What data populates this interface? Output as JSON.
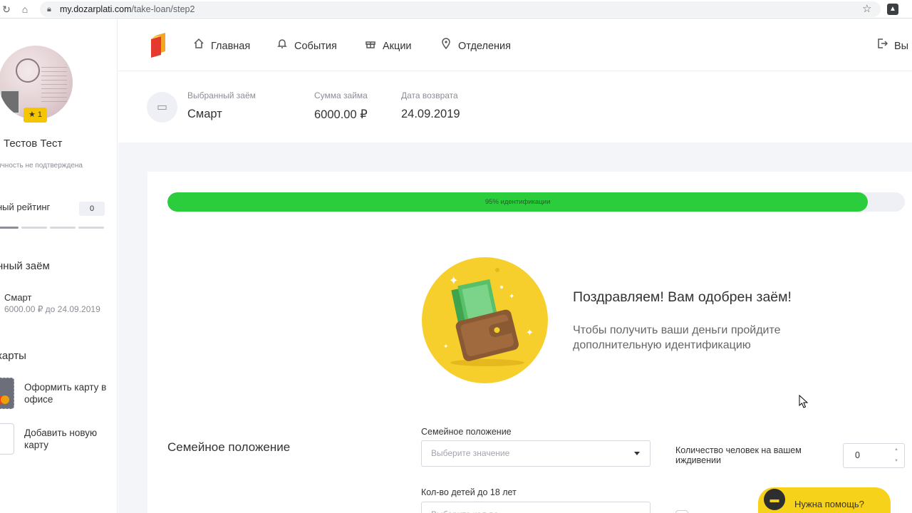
{
  "browser": {
    "url_host": "my.dozarplati.com",
    "url_path": "/take-loan/step2"
  },
  "sidebar": {
    "badge": "★ 1",
    "user_name": "Тестов Тест",
    "user_status": "ичность не подтверждена",
    "rating_label": "ный рейтинг",
    "rating_value": "0",
    "rating_progress": 0,
    "loan_section": "нный заём",
    "loan_name": "Смарт",
    "loan_sub": "6000.00 ₽ до 24.09.2019",
    "cards_section": "карты",
    "card_office_label": "Оформить карту в офисе",
    "card_new_label": "Добавить новую карту"
  },
  "nav": {
    "items": [
      {
        "label": "Главная",
        "icon": "home-icon"
      },
      {
        "label": "События",
        "icon": "bell-icon"
      },
      {
        "label": "Акции",
        "icon": "gift-icon"
      },
      {
        "label": "Отделения",
        "icon": "location-pin-icon"
      }
    ],
    "logout_label": "Вы"
  },
  "summary": {
    "chosen_label": "Выбранный заём",
    "chosen_value": "Смарт",
    "amount_label": "Сумма займа",
    "amount_value": "6000.00 ₽",
    "return_label": "Дата возврата",
    "return_value": "24.09.2019"
  },
  "progress": {
    "percent": 95,
    "label": "95% идентификации"
  },
  "approval": {
    "title": "Поздравляем! Вам одобрен заём!",
    "text": "Чтобы получить ваши деньги пройдите дополнительную идентификацию"
  },
  "form": {
    "section_title": "Семейное положение",
    "marital_label": "Семейное положение",
    "marital_placeholder": "Выберите значение",
    "dependents_label": "Количество человек на вашем иждивении",
    "dependents_value": "0",
    "children_label": "Кол-во детей до 18 лет",
    "children_placeholder": "Выберите кол-во"
  },
  "help": {
    "label": "Нужна помощь?"
  },
  "colors": {
    "progress_fill": "#2bcd3d",
    "accent_yellow": "#f7d21b",
    "badge_yellow": "#f5c500"
  }
}
